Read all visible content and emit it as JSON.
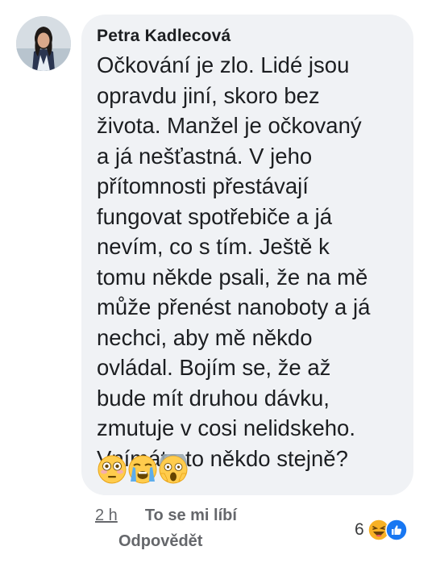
{
  "comment": {
    "author": "Petra Kadlecová",
    "text": "Očkování je zlo. Lidé jsou\nopravdu jiní, skoro bez\nživota. Manžel je očkovaný\na já nešťastná. V jeho\npřítomnosti přestávají\nfungovat spotřebiče a já\nnevím, co s tím. Ještě k\ntomu někde psali, že na mě\nmůže přenést nanoboty a já\nnechci, aby mě někdo\novládal. Bojím se, že až\nbude mít druhou dávku,\nzmutuje v cosi nelidskeho.\nVnímáte to někdo stejně?",
    "emojis": [
      "flushed-face",
      "loudly-crying-face",
      "face-screaming-in-fear"
    ]
  },
  "actions": {
    "timestamp": "2 h",
    "like_label": "To se mi líbí",
    "reply_label": "Odpovědět"
  },
  "reactions": {
    "count": "6",
    "types": [
      "haha",
      "like"
    ],
    "colors": {
      "haha": "#f7b125",
      "like": "#1877f2"
    }
  },
  "colors": {
    "bubble": "#f0f2f5",
    "text": "#1c1e21",
    "meta": "#65676b"
  }
}
